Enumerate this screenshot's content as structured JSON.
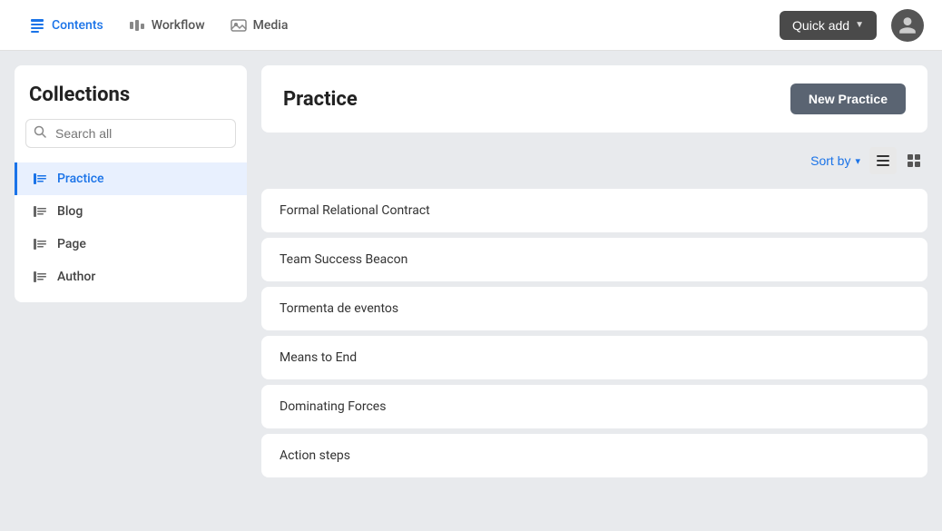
{
  "nav": {
    "items": [
      {
        "id": "contents",
        "label": "Contents",
        "active": true
      },
      {
        "id": "workflow",
        "label": "Workflow",
        "active": false
      },
      {
        "id": "media",
        "label": "Media",
        "active": false
      }
    ],
    "quick_add_label": "Quick add",
    "chevron": "▼"
  },
  "sidebar": {
    "title": "Collections",
    "search_placeholder": "Search all",
    "items": [
      {
        "id": "practice",
        "label": "Practice",
        "active": true
      },
      {
        "id": "blog",
        "label": "Blog",
        "active": false
      },
      {
        "id": "page",
        "label": "Page",
        "active": false
      },
      {
        "id": "author",
        "label": "Author",
        "active": false
      }
    ]
  },
  "content": {
    "title": "Practice",
    "new_button_label": "New Practice",
    "sort_by_label": "Sort by",
    "sort_chevron": "▾",
    "items": [
      {
        "id": 1,
        "title": "Formal Relational Contract"
      },
      {
        "id": 2,
        "title": "Team Success Beacon"
      },
      {
        "id": 3,
        "title": "Tormenta de eventos"
      },
      {
        "id": 4,
        "title": "Means to End"
      },
      {
        "id": 5,
        "title": "Dominating Forces"
      },
      {
        "id": 6,
        "title": "Action steps"
      }
    ]
  },
  "colors": {
    "accent": "#1a73e8",
    "nav_bg": "#ffffff",
    "sidebar_bg": "#ffffff",
    "card_bg": "#ffffff",
    "body_bg": "#e8eaed",
    "active_item_bg": "#e8f0fe",
    "new_btn_bg": "#5a6472"
  },
  "icons": {
    "search": "🔍",
    "contents": "📄",
    "workflow": "📊",
    "media": "🖼️",
    "list_view": "☰",
    "grid_view": "⊞"
  }
}
